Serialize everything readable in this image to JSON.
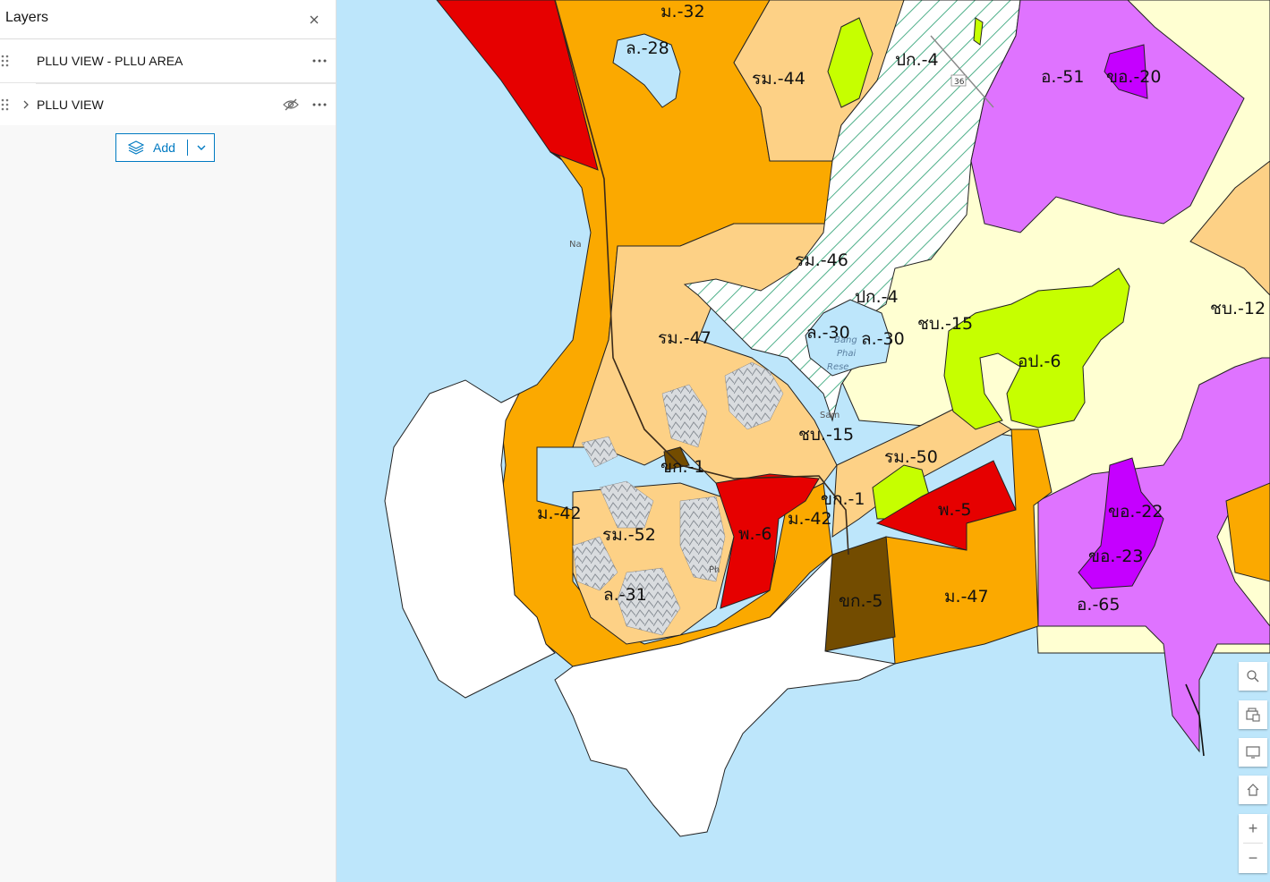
{
  "panel": {
    "title": "Layers",
    "layers": [
      {
        "label": "PLLU VIEW - PLLU AREA"
      },
      {
        "label": "PLLU VIEW"
      }
    ],
    "add_label": "Add"
  },
  "map": {
    "zones": [
      "ม.-32",
      "ล.-28",
      "รม.-44",
      "ปก.-4",
      "อ.-51",
      "ขอ.-20",
      "รม.-46",
      "ปก.-4",
      "ชบ.-12",
      "ชบ.-15",
      "รม.-47",
      "ล.-30",
      "ล.-30",
      "อป.-6",
      "ชบ.-15",
      "รม.-50",
      "ขก.-1",
      "ขก.-1",
      "ม.-42",
      "รม.-52",
      "พ.-6",
      "ม.-42",
      "พ.-5",
      "ขอ.-22",
      "ขอ.-23",
      "ล.-31",
      "ขก.-5",
      "ม.-47",
      "อ.-65"
    ],
    "basemap_labels": [
      "Na",
      "Sam",
      "Phai",
      "Bang",
      "Rese",
      "Ph",
      "36"
    ]
  },
  "colors": {
    "water": "#bde6fb",
    "orange": "#fba900",
    "red": "#e60000",
    "tan": "#fdd186",
    "purple": "#df73ff",
    "violet": "#c500ff",
    "lime": "#c6ff00",
    "cream": "#ffffd2",
    "brown": "#734c00",
    "accent": "#007ac2"
  },
  "tools": [
    "search-icon",
    "print-icon",
    "screen-icon",
    "home-icon",
    "zoom-in-icon",
    "zoom-out-icon"
  ],
  "zoom": {
    "in": "+",
    "out": "−"
  }
}
